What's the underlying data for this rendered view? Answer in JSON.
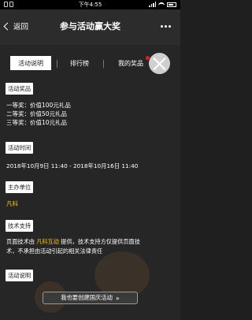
{
  "status_bar": {
    "time": "下午4:55"
  },
  "nav": {
    "back_label": "返回",
    "title": "参与活动赢大奖"
  },
  "tabs": [
    {
      "label": "活动说明",
      "active": true
    },
    {
      "label": "排行榜",
      "active": false
    },
    {
      "label": "我的奖品",
      "active": false,
      "badge": true
    }
  ],
  "sections": {
    "prize": {
      "label": "活动奖品",
      "lines": [
        "一等奖：价值100元礼品",
        "二等奖：价值50元礼品",
        "三等奖：价值10元礼品"
      ]
    },
    "time": {
      "label": "活动时间",
      "value": "2018年10月9日 11:40 - 2018年10月16日 11:40"
    },
    "organizer": {
      "label": "主办单位",
      "value": "凡科"
    },
    "tech": {
      "label": "技术支持",
      "line1_pre": "页面技术由 ",
      "line1_link": "凡科互动",
      "line1_post": " 提供，技术支持方仅提供页面技",
      "line2": "术，不承担由活动引起的相关法律责任"
    },
    "desc": {
      "label": "活动说明"
    }
  },
  "bottom_button": {
    "label": "我也要创建国庆活动",
    "arrow": "»"
  },
  "colors": {
    "highlight": "#f5c518",
    "badge": "#e02020"
  }
}
